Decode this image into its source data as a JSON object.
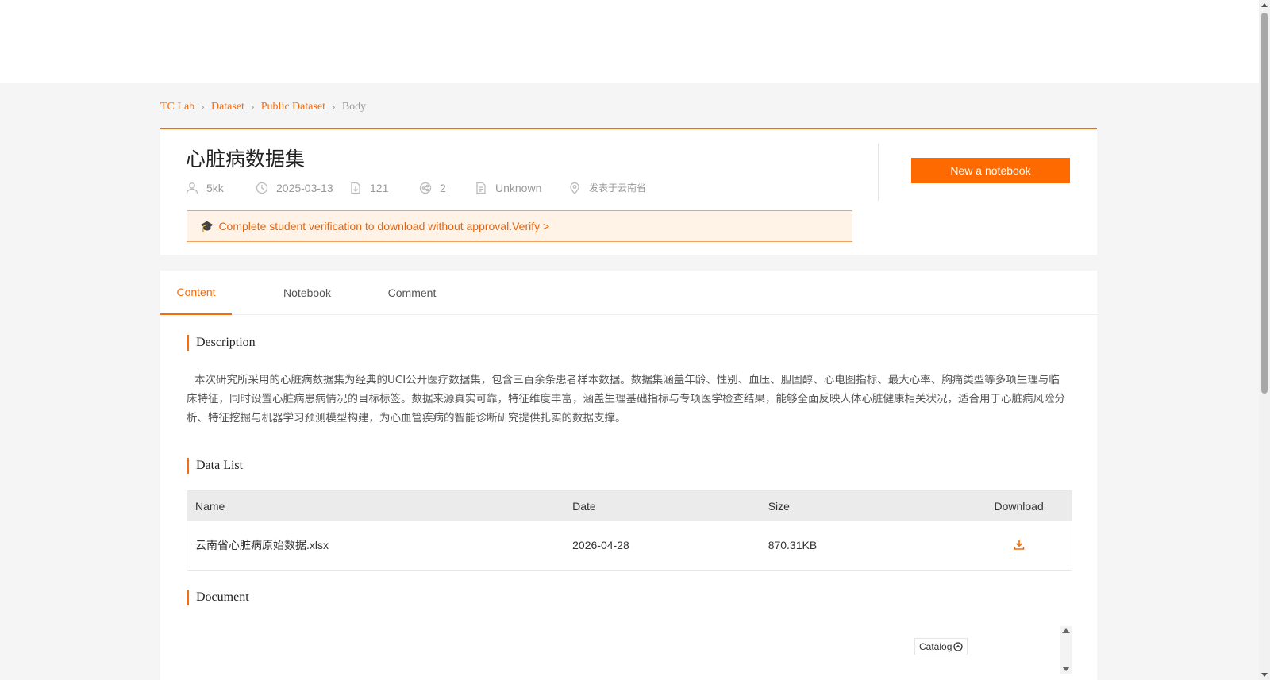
{
  "breadcrumb": {
    "items": [
      "TC Lab",
      "Dataset",
      "Public Dataset"
    ],
    "current": "Body"
  },
  "dataset": {
    "title": "心脏病数据集",
    "author": "5kk",
    "date": "2025-03-13",
    "downloads": "121",
    "shares": "2",
    "license": "Unknown",
    "location": "发表于云南省"
  },
  "actions": {
    "new_notebook": "New a notebook"
  },
  "notice": {
    "text": "Complete student verification to download without approval.",
    "link": "Verify >"
  },
  "tabs": [
    "Content",
    "Notebook",
    "Comment"
  ],
  "sections": {
    "description": "Description",
    "data_list": "Data List",
    "document": "Document"
  },
  "description_text": "本次研究所采用的心脏病数据集为经典的UCI公开医疗数据集，包含三百余条患者样本数据。数据集涵盖年龄、性别、血压、胆固醇、心电图指标、最大心率、胸痛类型等多项生理与临床特征，同时设置心脏病患病情况的目标标签。数据来源真实可靠，特征维度丰富，涵盖生理基础指标与专项医学检查结果，能够全面反映人体心脏健康相关状况，适合用于心脏病风险分析、特征挖掘与机器学习预测模型构建，为心血管疾病的智能诊断研究提供扎实的数据支撑。",
  "table": {
    "headers": [
      "Name",
      "Date",
      "Size",
      "Download"
    ],
    "rows": [
      {
        "name": "云南省心脏病原始数据.xlsx",
        "date": "2026-04-28",
        "size": "870.31KB"
      }
    ]
  },
  "catalog_label": "Catalog",
  "colors": {
    "accent": "#f56c0d",
    "button": "#ff6a00",
    "notice_bg": "#fff3e8"
  },
  "icons": [
    "user-icon",
    "clock-icon",
    "download-count-icon",
    "share-icon",
    "document-icon",
    "location-icon",
    "graduation-cap-icon",
    "download-icon",
    "chevron-circle-icon"
  ]
}
